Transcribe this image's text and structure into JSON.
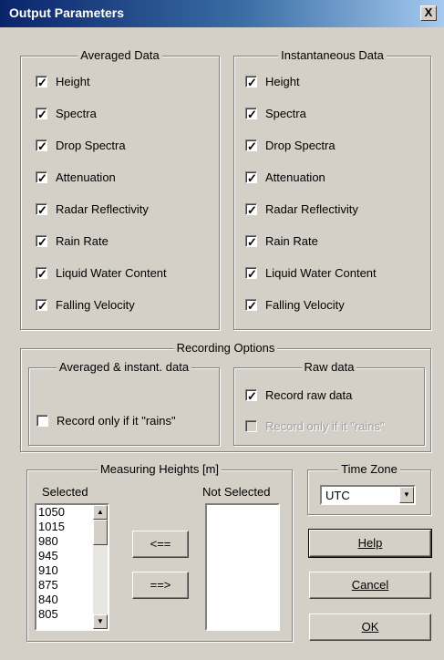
{
  "window": {
    "title": "Output Parameters",
    "close_glyph": "X"
  },
  "averaged": {
    "title": "Averaged Data",
    "items": [
      {
        "label": "Height",
        "checked": true
      },
      {
        "label": "Spectra",
        "checked": true
      },
      {
        "label": "Drop Spectra",
        "checked": true
      },
      {
        "label": "Attenuation",
        "checked": true
      },
      {
        "label": "Radar Reflectivity",
        "checked": true
      },
      {
        "label": "Rain Rate",
        "checked": true
      },
      {
        "label": "Liquid Water Content",
        "checked": true
      },
      {
        "label": "Falling Velocity",
        "checked": true
      }
    ]
  },
  "instantaneous": {
    "title": "Instantaneous Data",
    "items": [
      {
        "label": "Height",
        "checked": true
      },
      {
        "label": "Spectra",
        "checked": true
      },
      {
        "label": "Drop Spectra",
        "checked": true
      },
      {
        "label": "Attenuation",
        "checked": true
      },
      {
        "label": "Radar Reflectivity",
        "checked": true
      },
      {
        "label": "Rain Rate",
        "checked": true
      },
      {
        "label": "Liquid Water Content",
        "checked": true
      },
      {
        "label": "Falling Velocity",
        "checked": true
      }
    ]
  },
  "recording": {
    "title": "Recording Options",
    "avg_inst_title": "Averaged & instant. data",
    "avg_inst_option": {
      "label": "Record only if it \"rains\"",
      "checked": false
    },
    "raw_title": "Raw data",
    "raw_record": {
      "label": "Record raw data",
      "checked": true
    },
    "raw_only_rains": {
      "label": "Record only if it \"rains\"",
      "checked": false,
      "disabled": true
    }
  },
  "heights": {
    "title": "Measuring Heights [m]",
    "selected_label": "Selected",
    "not_selected_label": "Not Selected",
    "selected": [
      "1050",
      "1015",
      "980",
      "945",
      "910",
      "875",
      "840",
      "805"
    ],
    "not_selected": [],
    "move_left": "<==",
    "move_right": "==>"
  },
  "timezone": {
    "title": "Time Zone",
    "value": "UTC"
  },
  "buttons": {
    "help": "Help",
    "cancel": "Cancel",
    "ok": "OK"
  }
}
